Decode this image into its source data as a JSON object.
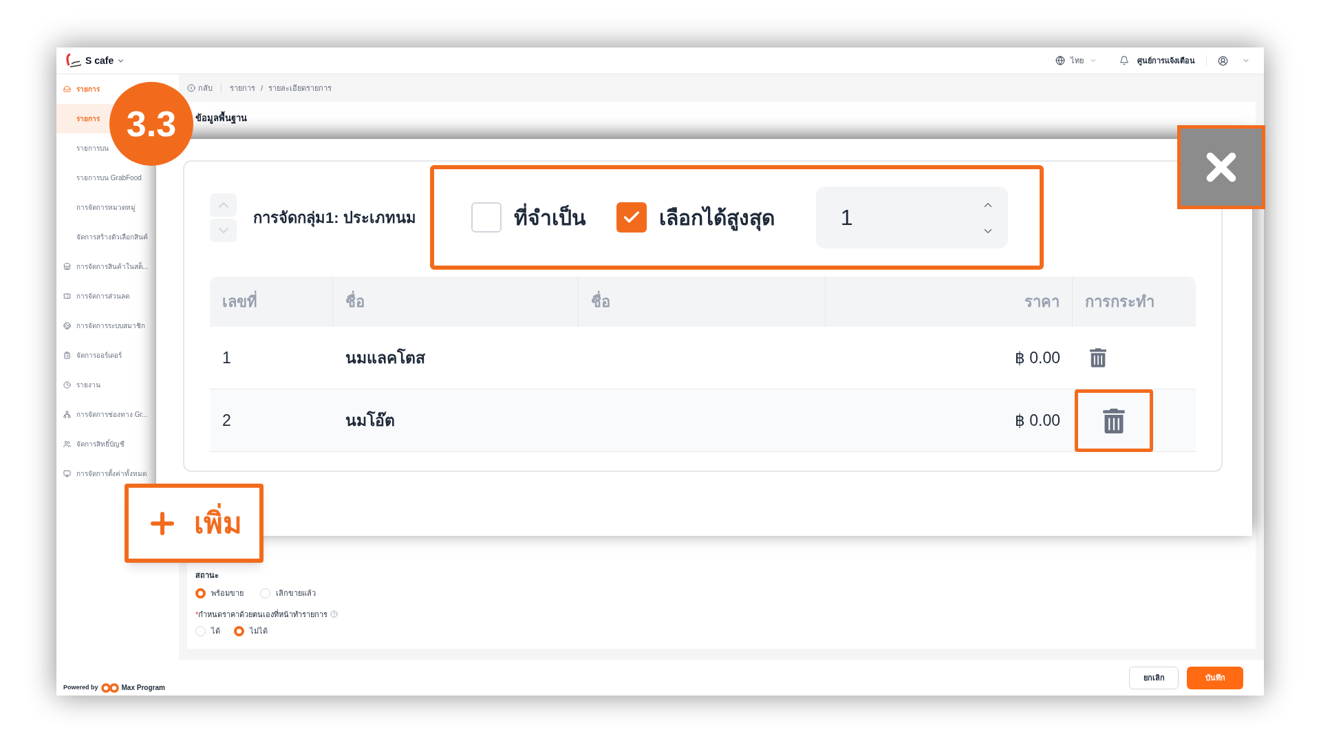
{
  "header": {
    "brand": "S cafe",
    "language": "ไทย",
    "notifications": "ศูนย์การแจ้งเตือน"
  },
  "sidebar": {
    "items": [
      {
        "label": "รายการ",
        "selected": false,
        "children": [
          {
            "label": "รายการ",
            "selected": true
          },
          {
            "label": "รายการบน",
            "selected": false
          },
          {
            "label": "รายการบน GrabFood",
            "selected": false
          },
          {
            "label": "การจัดการหมวดหมู่",
            "selected": false
          },
          {
            "label": "จัดการสร้างตัวเลือกสินค้",
            "selected": false
          }
        ]
      },
      {
        "label": "การจัดการสินค้าในสต็...",
        "selected": false
      },
      {
        "label": "การจัดการส่วนลด",
        "selected": false
      },
      {
        "label": "การจัดการระบบสมาชิก",
        "selected": false
      },
      {
        "label": "จัดการออร์เดอร์",
        "selected": false
      },
      {
        "label": "รายงาน",
        "selected": false
      },
      {
        "label": "การจัดการช่องทาง Gr...",
        "selected": false
      },
      {
        "label": "จัดการสิทธิ์บัญชี",
        "selected": false
      },
      {
        "label": "การจัดการตั้งค่าทั้งหมด",
        "selected": false
      }
    ],
    "footer": {
      "powered_by": "Powered by",
      "brand": "Max Program"
    }
  },
  "breadcrumb": {
    "back": "กลับ",
    "path": [
      "รายการ",
      "รายละเอียดรายการ"
    ],
    "separator": "/"
  },
  "section": {
    "title": "ข้อมูลพื้นฐาน"
  },
  "status": {
    "label": "สถานะ",
    "options": [
      {
        "label": "พร้อมขาย",
        "selected": true
      },
      {
        "label": "เลิกขายแล้ว",
        "selected": false
      }
    ]
  },
  "manual_price": {
    "required_mark": "*",
    "label": "กำหนดราคาด้วยตนเองที่หน้าทำรายการ",
    "options": [
      {
        "label": "ได้",
        "selected": false
      },
      {
        "label": "ไม่ได้",
        "selected": true
      }
    ]
  },
  "footer": {
    "buttons": [
      {
        "label": "ยกเลิก",
        "kind": "secondary"
      },
      {
        "label": "บันทึก",
        "kind": "primary"
      }
    ]
  },
  "callout": {
    "step": "3.3",
    "add_label": "เพิ่ม",
    "group": {
      "title": "การจัดกลุ่ม1: ประเภทนม",
      "move_up_disabled": true,
      "move_down_disabled": true
    },
    "required": {
      "label": "ที่จำเป็น",
      "checked": false
    },
    "max_select": {
      "label": "เลือกได้สูงสุด",
      "checked": true,
      "value": "1"
    },
    "table": {
      "columns": [
        "เลขที่",
        "ชื่อ",
        "ชื่อ",
        "ราคา",
        "การกระทำ"
      ],
      "rows": [
        {
          "number": "1",
          "name": "นมแลคโตส",
          "price": "฿ 0.00",
          "highlighted": false
        },
        {
          "number": "2",
          "name": "นมโอ๊ต",
          "price": "฿ 0.00",
          "highlighted": true
        }
      ]
    }
  }
}
